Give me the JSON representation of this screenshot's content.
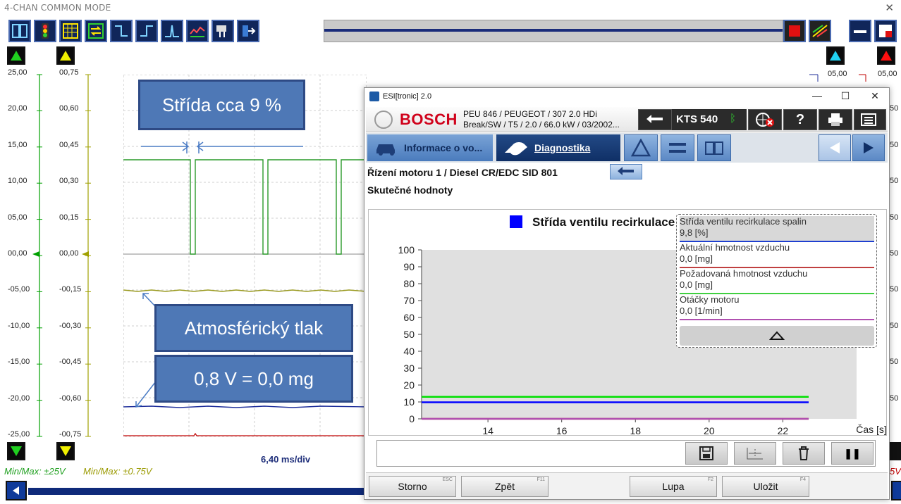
{
  "scope": {
    "title": "4-CHAN COMMON MODE",
    "close": "✕",
    "left_axis_1": [
      "25,00",
      "20,00",
      "15,00",
      "10,00",
      "05,00",
      "00,00",
      "-05,00",
      "-10,00",
      "-15,00",
      "-20,00",
      "-25,00"
    ],
    "left_axis_2": [
      "00,75",
      "00,60",
      "00,45",
      "00,30",
      "00,15",
      "00,00",
      "-00,15",
      "-00,30",
      "-00,45",
      "-00,60",
      "-00,75"
    ],
    "right_axis_1_top": "05,00",
    "right_axis_2_top": "05,00",
    "right_axis_2_visible": [
      "05,00",
      "50",
      "50",
      "50",
      "50",
      "50",
      "50",
      "50",
      "50",
      "50"
    ],
    "minmax_1": "Min/Max: ±25V",
    "minmax_2": "Min/Max: ±0.75V",
    "minmax_right": "5V",
    "timebase": "6,40 ms/div",
    "callout_duty": "Střída cca 9 %",
    "callout_atm": "Atmosférický tlak",
    "callout_volt": "0,8 V = 0,0 mg",
    "colors": {
      "ch1": "#00a000",
      "ch2": "#b8b800",
      "ch3": "#1e2e9a",
      "ch4": "#c00000"
    }
  },
  "esi": {
    "title": "ESI[tronic] 2.0",
    "brand": "BOSCH",
    "vehicle_line1": "PEU 846 / PEUGEOT / 307 2.0 HDi",
    "vehicle_line2": "Break/SW / T5 / 2.0 / 66.0 kW / 03/2002...",
    "device": "KTS 540",
    "tab_info": "Informace o vo...",
    "tab_diag": "Diagnostika",
    "path": "Řízení motoru 1 / Diesel CR/EDC SID 801",
    "subtitle": "Skutečné hodnoty",
    "legend": [
      {
        "name": "Střída ventilu recirkulace spalin",
        "value": "9,8 [%]",
        "color": "#1e3fd0"
      },
      {
        "name": "Aktuální hmotnost vzduchu",
        "value": "0,0 [mg]",
        "color": "#c04040"
      },
      {
        "name": "Požadovaná hmotnost vzduchu",
        "value": "0,0 [mg]",
        "color": "#40d040"
      },
      {
        "name": "Otáčky motoru",
        "value": "0,0 [1/min]",
        "color": "#b050b0"
      }
    ],
    "footer": [
      {
        "label": "Storno",
        "key": "ESC"
      },
      {
        "label": "Zpět",
        "key": "F11"
      },
      {
        "label": "Lupa",
        "key": "F2"
      },
      {
        "label": "Uložit",
        "key": "F4"
      }
    ]
  },
  "chart_data": {
    "type": "line",
    "title": "Střída ventilu recirkulace spalin",
    "xlabel": "Čas [s]",
    "ylabel": "",
    "ylim": [
      0,
      100
    ],
    "xlim": [
      12.2,
      24.0
    ],
    "yticks": [
      0,
      10,
      20,
      30,
      40,
      50,
      60,
      70,
      80,
      90,
      100
    ],
    "xticks": [
      14,
      16,
      18,
      20,
      22
    ],
    "series": [
      {
        "name": "Střída ventilu recirkulace spalin",
        "color": "#0000ff",
        "x": [
          12.2,
          22.7
        ],
        "y": [
          9.8,
          9.8
        ]
      },
      {
        "name": "Aktuální hmotnost vzduchu",
        "color": "#c04040",
        "x": [
          12.2,
          22.7
        ],
        "y": [
          0.0,
          0.0
        ]
      },
      {
        "name": "Požadovaná hmotnost vzduchu",
        "color": "#00e000",
        "x": [
          12.2,
          22.7
        ],
        "y": [
          13.0,
          13.0
        ]
      },
      {
        "name": "Otáčky motoru",
        "color": "#b050b0",
        "x": [
          12.2,
          22.7
        ],
        "y": [
          0.0,
          0.0
        ]
      }
    ]
  }
}
